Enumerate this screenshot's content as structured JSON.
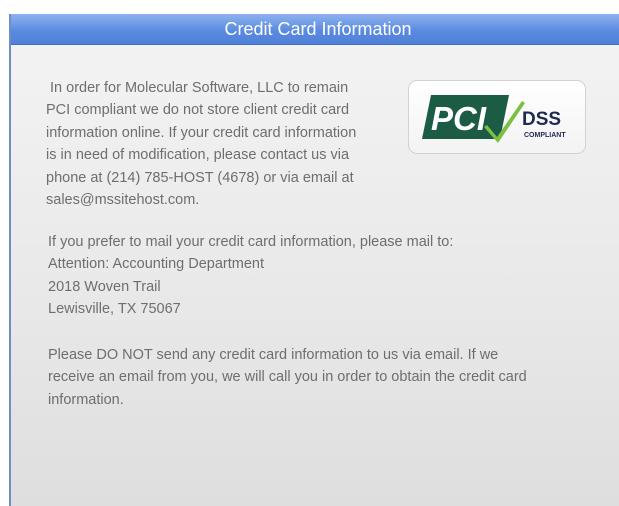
{
  "header": {
    "title": "Credit Card Information"
  },
  "intro": {
    "lines": [
      " In order for Molecular Software, LLC to remain",
      "PCI compliant we do not store client credit card",
      "information online. If your credit card information",
      "is in need of modification, please contact us via",
      "phone at (214) 785-HOST (4678) or via email at",
      "sales@mssitehost.com."
    ]
  },
  "mail": {
    "lines": [
      "If you prefer to mail your credit card information, please mail to:",
      "Attention: Accounting Department",
      "2018 Woven Trail",
      "Lewisville, TX 75067"
    ]
  },
  "warning": {
    "lines": [
      "Please DO NOT send any credit card information to us via email. If we",
      "receive an email from you, we will call you in order to obtain the credit card",
      "information."
    ]
  },
  "badge": {
    "pci_text": "PCI",
    "dss_text": "DSS",
    "compliant_text": "COMPLIANT",
    "colors": {
      "pci_dark_green": "#1c5c45",
      "dss_navy": "#1f2a52",
      "check_green": "#7cc043"
    }
  }
}
